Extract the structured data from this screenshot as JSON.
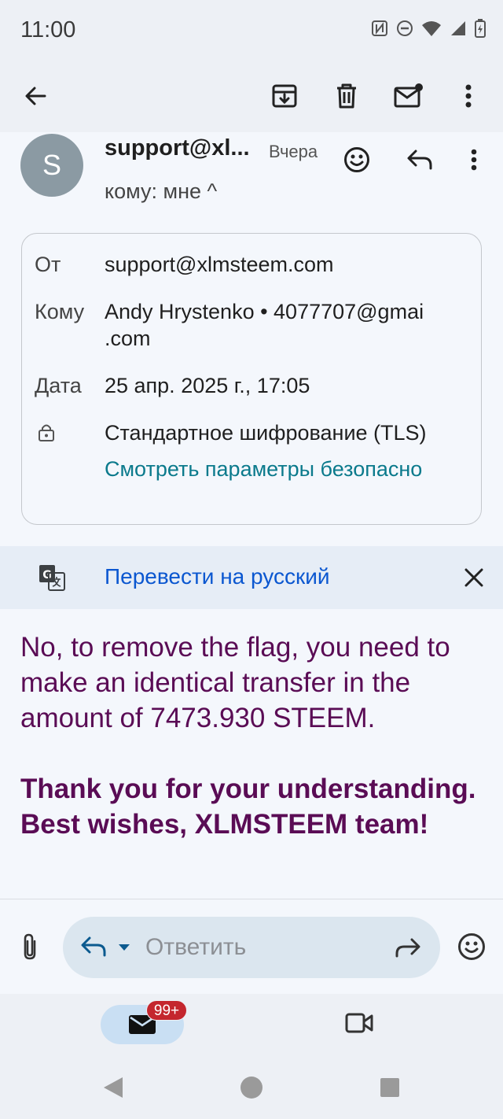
{
  "status_bar": {
    "time": "11:00"
  },
  "toolbar": {
    "back": "back-icon",
    "archive": "archive-icon",
    "delete": "trash-icon",
    "mark_unread": "mark-unread-icon",
    "more": "more-vert-icon"
  },
  "message": {
    "avatar_letter": "S",
    "sender": "support@xl...",
    "date": "Вчера",
    "recipient_line": "кому: мне ^"
  },
  "details": {
    "from_label": "От",
    "from_value": "support@xlmsteem.com",
    "to_label": "Кому",
    "to_value_line1": "Andy Hrystenko • 4077707@gmai",
    "to_value_line2": ".com",
    "date_label": "Дата",
    "date_value": "25 апр. 2025 г., 17:05",
    "encryption": "Стандартное шифрование (TLS)",
    "security_link": "Смотреть параметры безопасно"
  },
  "translate": {
    "label": "Перевести на русский"
  },
  "body": {
    "paragraph1": "No, to remove the flag, you need to make an identical transfer in the amount of 7473.930 STEEM.",
    "paragraph2": "Thank you for your understanding. Best wishes, XLMSTEEM team!"
  },
  "reply": {
    "placeholder": "Ответить"
  },
  "bottom_nav": {
    "mail_badge": "99+"
  },
  "colors": {
    "accent": "#0b57d0",
    "link": "#0b7a8c",
    "body_text": "#5a0c55",
    "badge": "#c4262e"
  }
}
